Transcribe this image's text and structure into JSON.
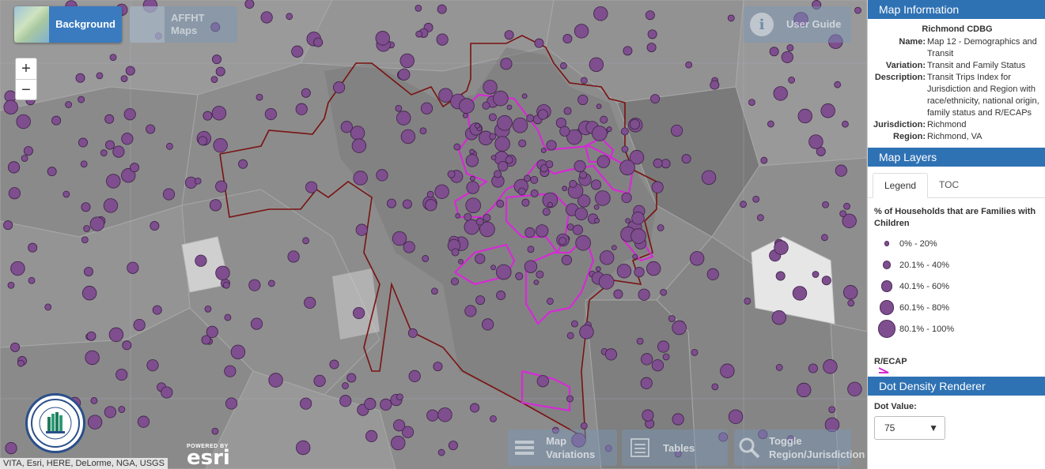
{
  "toolbar": {
    "background_label": "Background",
    "affht_label": "AFFHT Maps",
    "guide_label": "User Guide"
  },
  "zoom": {
    "in_label": "+",
    "out_label": "−"
  },
  "bottom_buttons": {
    "variations_label": "Map Variations",
    "tables_label": "Tables",
    "toggle_label": "Toggle Region/Jurisdiction"
  },
  "attribution": "VITA, Esri, HERE, DeLorme, NGA, USGS",
  "esri": {
    "powered_by": "POWERED BY",
    "name": "esri"
  },
  "map_information": {
    "header": "Map Information",
    "title": "Richmond CDBG",
    "rows": [
      {
        "key": "Name:",
        "value": "Map 12 - Demographics and Transit"
      },
      {
        "key": "Variation:",
        "value": "Transit and Family Status"
      },
      {
        "key": "Description:",
        "value": "Transit Trips Index for Jurisdiction and Region with race/ethnicity, national origin, family status and R/ECAPs"
      },
      {
        "key": "Jurisdiction:",
        "value": "Richmond"
      },
      {
        "key": "Region:",
        "value": "Richmond, VA"
      }
    ]
  },
  "map_layers": {
    "header": "Map Layers",
    "tabs": [
      "Legend",
      "TOC"
    ],
    "legend_title": "% of Households that are Families with Children",
    "legend_items": [
      {
        "label": "0% - 20%"
      },
      {
        "label": "20.1% - 40%"
      },
      {
        "label": "40.1% - 60%"
      },
      {
        "label": "60.1% - 80%"
      },
      {
        "label": "80.1% - 100%"
      }
    ],
    "recap_label": "R/ECAP"
  },
  "dot_density": {
    "header": "Dot Density Renderer",
    "label": "Dot Value:",
    "value": "75"
  },
  "colors": {
    "dot_fill": "#7e4e8e",
    "recap_outline": "#d62ad6",
    "jurisdiction_outline": "#7a1010",
    "panel_header": "#2f72b4"
  }
}
